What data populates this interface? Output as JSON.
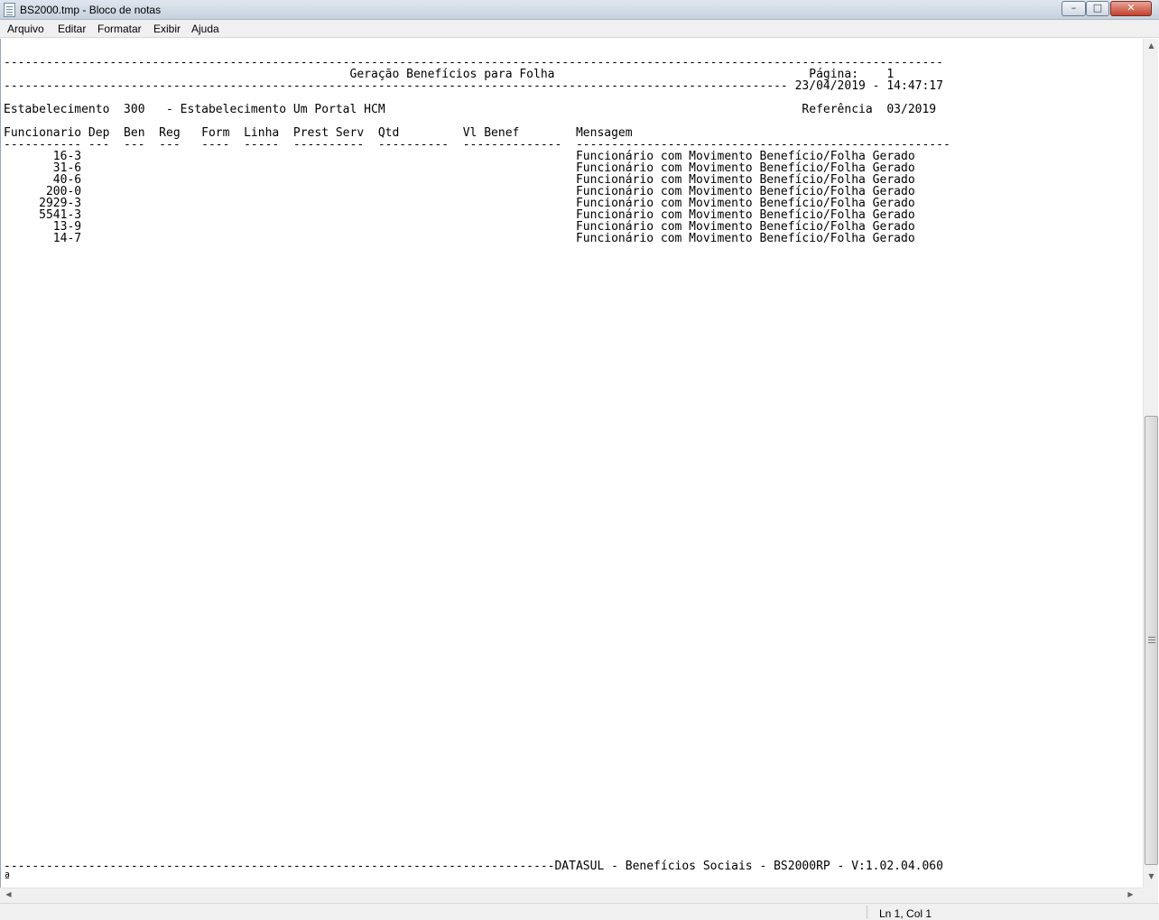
{
  "window": {
    "title": "BS2000.tmp - Bloco de notas",
    "buttons": {
      "minimize": "–",
      "maximize": "□",
      "close": "✕"
    }
  },
  "menu": {
    "items": [
      "Arquivo",
      "Editar",
      "Formatar",
      "Exibir",
      "Ajuda"
    ]
  },
  "document": {
    "rule_top": "-------------------------------------------------------------------------------------------------------------------------------------",
    "title_line": "                                                 Geração Benefícios para Folha                                    Página:    1",
    "date_line": "--------------------------------------------------------------------------------------------------------------- 23/04/2019 - 14:47:17",
    "blank_1": "",
    "estab_line": "Estabelecimento  300   - Estabelecimento Um Portal HCM                                                           Referência  03/2019",
    "blank_2": "",
    "columns_line": "Funcionario Dep  Ben  Reg   Form  Linha  Prest Serv  Qtd         Vl Benef        Mensagem",
    "columns_rule": "----------- ---  ---  ---   ----  -----  ----------  ----------  --------------  -----------------------------------------------------",
    "rows": [
      "       16-3                                                                      Funcionário com Movimento Benefício/Folha Gerado",
      "       31-6                                                                      Funcionário com Movimento Benefício/Folha Gerado",
      "       40-6                                                                      Funcionário com Movimento Benefício/Folha Gerado",
      "      200-0                                                                      Funcionário com Movimento Benefício/Folha Gerado",
      "     2929-3                                                                      Funcionário com Movimento Benefício/Folha Gerado",
      "     5541-3                                                                      Funcionário com Movimento Benefício/Folha Gerado",
      "       13-9                                                                      Funcionário com Movimento Benefício/Folha Gerado",
      "       14-7                                                                      Funcionário com Movimento Benefício/Folha Gerado"
    ],
    "footer_line": "------------------------------------------------------------------------------DATASUL - Benefícios Sociais - BS2000RP - V:1.02.04.060",
    "footer_marker": "ª"
  },
  "status": {
    "position": "Ln 1, Col 1"
  }
}
